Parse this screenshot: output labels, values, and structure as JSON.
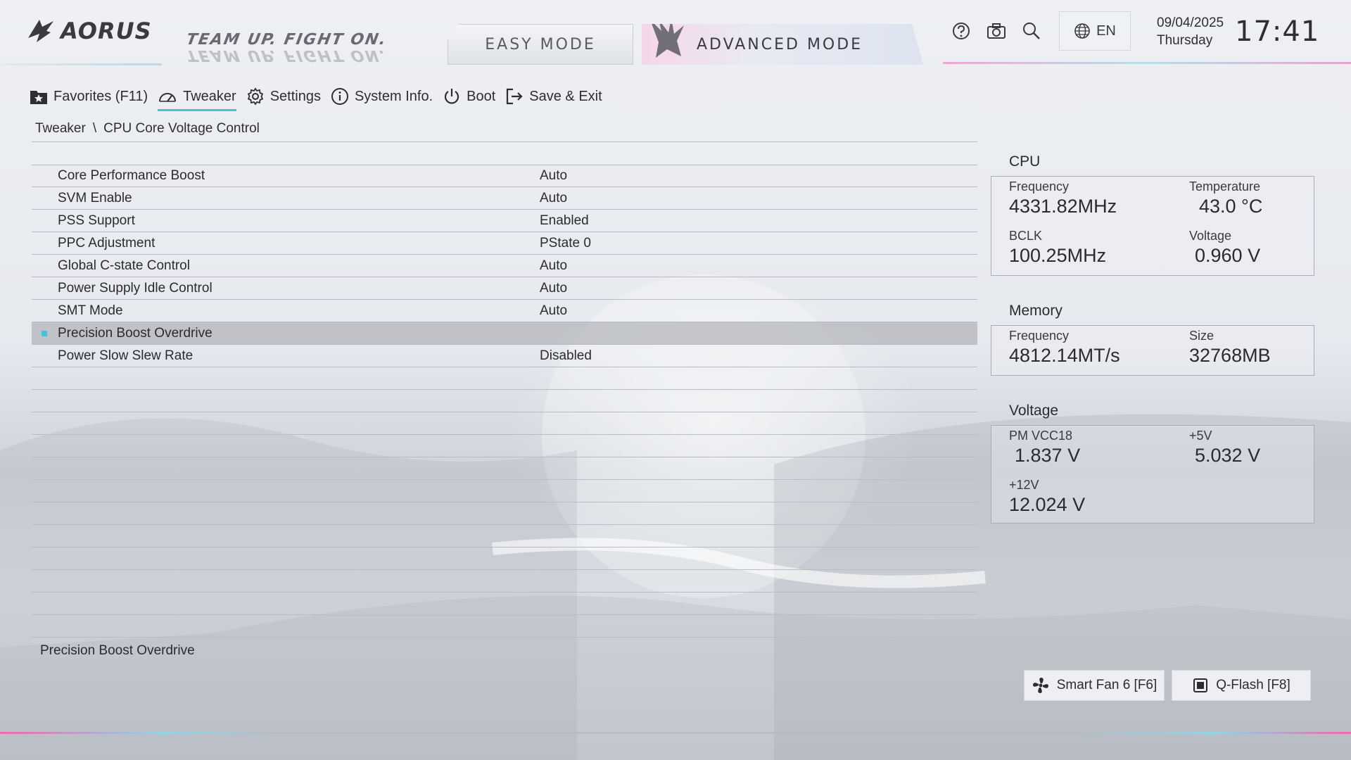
{
  "brand": {
    "logo": "AORUS",
    "slogan": "TEAM UP. FIGHT ON."
  },
  "modes": {
    "easy": "EASY MODE",
    "advanced": "ADVANCED MODE"
  },
  "top_icons": [
    "help-icon",
    "camera-icon",
    "search-icon"
  ],
  "language": "EN",
  "datetime": {
    "date": "09/04/2025",
    "day": "Thursday",
    "time": "17:41"
  },
  "nav": [
    {
      "label": "Favorites (F11)",
      "icon": "star-folder-icon",
      "active": false
    },
    {
      "label": "Tweaker",
      "icon": "speedometer-icon",
      "active": true
    },
    {
      "label": "Settings",
      "icon": "gear-icon",
      "active": false
    },
    {
      "label": "System Info.",
      "icon": "info-icon",
      "active": false
    },
    {
      "label": "Boot",
      "icon": "power-icon",
      "active": false
    },
    {
      "label": "Save & Exit",
      "icon": "exit-icon",
      "active": false
    }
  ],
  "breadcrumb": {
    "root": "Tweaker",
    "separator": "\\",
    "current": "CPU Core Voltage Control"
  },
  "settings": [
    {
      "label": "Core Performance Boost",
      "value": "Auto"
    },
    {
      "label": "SVM Enable",
      "value": "Auto"
    },
    {
      "label": "PSS Support",
      "value": "Enabled"
    },
    {
      "label": "PPC Adjustment",
      "value": "PState 0"
    },
    {
      "label": "Global C-state Control",
      "value": "Auto"
    },
    {
      "label": "Power Supply Idle Control",
      "value": "Auto"
    },
    {
      "label": "SMT Mode",
      "value": "Auto"
    },
    {
      "label": "Precision Boost Overdrive",
      "value": "",
      "selected": true
    },
    {
      "label": "Power Slow Slew Rate",
      "value": "Disabled"
    }
  ],
  "help_text": "Precision Boost Overdrive",
  "cpu": {
    "title": "CPU",
    "frequency_label": "Frequency",
    "frequency": "4331.82MHz",
    "temperature_label": "Temperature",
    "temperature": "43.0 °C",
    "bclk_label": "BCLK",
    "bclk": "100.25MHz",
    "voltage_label": "Voltage",
    "voltage": "0.960 V"
  },
  "memory": {
    "title": "Memory",
    "frequency_label": "Frequency",
    "frequency": "4812.14MT/s",
    "size_label": "Size",
    "size": "32768MB"
  },
  "voltage": {
    "title": "Voltage",
    "pm_vcc18_label": "PM VCC18",
    "pm_vcc18": "1.837 V",
    "v5_label": "+5V",
    "v5": "5.032 V",
    "v12_label": "+12V",
    "v12": "12.024 V"
  },
  "buttons": {
    "smart_fan": "Smart Fan 6 [F6]",
    "qflash": "Q-Flash [F8]"
  },
  "colors": {
    "accent_cyan": "#45c2d9",
    "accent_pink": "#e85aa8",
    "selected_row": "#a0a3a8"
  }
}
